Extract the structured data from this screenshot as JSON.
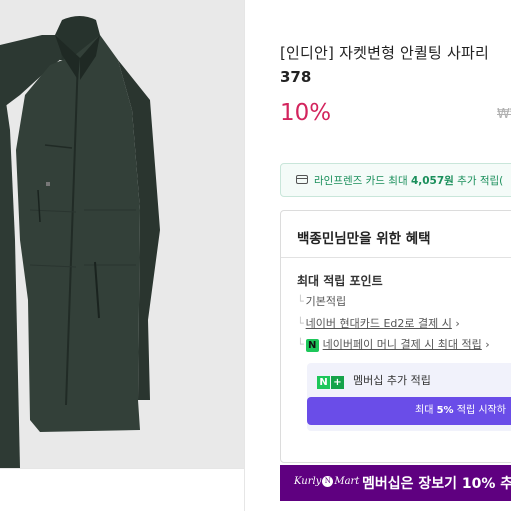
{
  "product": {
    "title": "[인디안] 자켓변형 안퀼팅 사파리",
    "title_line2": "378",
    "discount": "10%",
    "original_price": "₩₩"
  },
  "card_benefit": {
    "icon": "card-icon",
    "text_prefix": "라인프렌즈 카드 최대 ",
    "amount": "4,057원",
    "text_suffix": " 추가 적립(",
    "accent_color": "#1a8f5b"
  },
  "benefits": {
    "header": "백종민님만을 위한 혜택",
    "max_points_label": "최대 적립 포인트",
    "rows": [
      {
        "label": "기본적립"
      },
      {
        "label": "네이버 현대카드 Ed2로 결제 시",
        "chevron": "›"
      },
      {
        "badge": "N",
        "label": "네이버페이 머니 결제 시 최대 적립",
        "chevron": "›"
      }
    ],
    "membership": {
      "badge_n": "N",
      "badge_plus": "+",
      "label": "멤버십 추가 적립",
      "button_prefix": "최대 ",
      "button_percent": "5%",
      "button_suffix": " 적립 시작하",
      "button_color": "#6a4de8"
    }
  },
  "kurly_banner": {
    "logo_left": "Kurly",
    "logo_mid": "N",
    "logo_right": "Mart",
    "text": "멤버십은 장보기 10% 추",
    "color": "#5f0080"
  },
  "colors": {
    "discount": "#d3245d",
    "naver_green": "#1dc75a"
  }
}
